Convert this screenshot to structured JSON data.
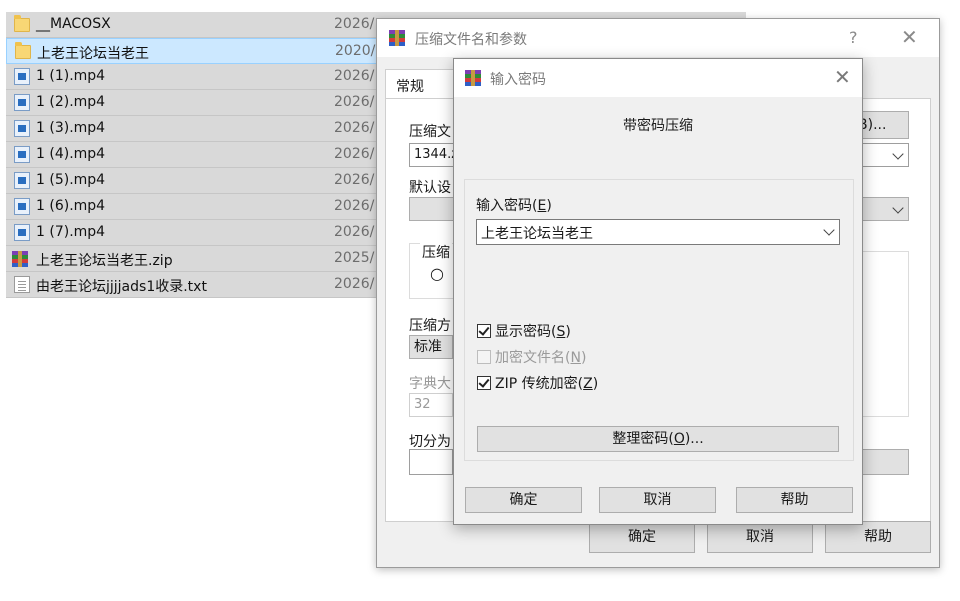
{
  "explorer": {
    "files": [
      {
        "name": "__MACOSX",
        "date": "2026/",
        "icon": "folder-icon"
      },
      {
        "name": "上老王论坛当老王",
        "date": "2020/",
        "icon": "folder-icon",
        "selected": true
      },
      {
        "name": "1 (1).mp4",
        "date": "2026/",
        "icon": "video-file-icon"
      },
      {
        "name": "1 (2).mp4",
        "date": "2026/",
        "icon": "video-file-icon"
      },
      {
        "name": "1 (3).mp4",
        "date": "2026/",
        "icon": "video-file-icon"
      },
      {
        "name": "1 (4).mp4",
        "date": "2026/",
        "icon": "video-file-icon"
      },
      {
        "name": "1 (5).mp4",
        "date": "2026/",
        "icon": "video-file-icon"
      },
      {
        "name": "1 (6).mp4",
        "date": "2026/",
        "icon": "video-file-icon"
      },
      {
        "name": "1 (7).mp4",
        "date": "2026/",
        "icon": "video-file-icon"
      },
      {
        "name": "上老王论坛当老王.zip",
        "date": "2025/",
        "icon": "winrar-archive-icon"
      },
      {
        "name": "由老王论坛jjjjads1收录.txt",
        "date": "2026/",
        "icon": "text-file-icon"
      }
    ]
  },
  "archive_dialog": {
    "title": "压缩文件名和参数",
    "help": "?",
    "close": "✕",
    "tab_general": "常规",
    "archive_name_label": "压缩文",
    "archive_name_value": "1344.z",
    "browse_button": "B)...",
    "default_profile_label": "默认设",
    "format_label": "压缩",
    "format_radio": "○",
    "method_label": "压缩方",
    "method_value": "标准",
    "dict_label": "字典大",
    "dict_value": "32",
    "split_label": "切分为",
    "ok_button": "确定",
    "cancel_button": "取消",
    "help_button": "帮助"
  },
  "password_dialog": {
    "title": "输入密码",
    "close": "✕",
    "heading": "带密码压缩",
    "password_label": "输入密码",
    "password_label_key": "E",
    "password_value": "上老王论坛当老王",
    "show_password": {
      "label": "显示密码",
      "key": "S",
      "checked": true
    },
    "encrypt_filenames": {
      "label": "加密文件名",
      "key": "N",
      "checked": false
    },
    "zip_legacy": {
      "label": "ZIP 传统加密",
      "key": "Z",
      "checked": true
    },
    "organize_button": "整理密码",
    "organize_key": "O",
    "ok_button": "确定",
    "cancel_button": "取消",
    "help_button": "帮助"
  }
}
